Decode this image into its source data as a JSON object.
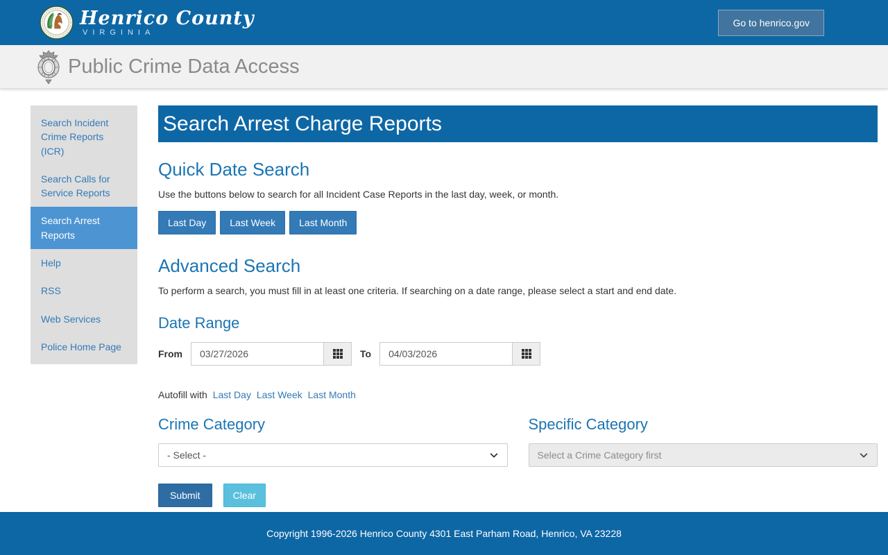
{
  "theme": {
    "bar_blue": "#0e67a5",
    "heading_blue": "#1b75b3",
    "link_blue": "#337ab7",
    "active_item_blue": "#4d94d2",
    "submit_blue": "#2e6da4",
    "clear_blue": "#5bc0de"
  },
  "top_bar": {
    "logo_title": "Henrico County",
    "logo_subtitle": "VIRGINIA",
    "go_button_label": "Go to henrico.gov"
  },
  "site_header": {
    "title": "Public Crime Data Access"
  },
  "sidebar": {
    "items": [
      {
        "label": "Search Incident Crime Reports (ICR)",
        "active": false
      },
      {
        "label": "Search Calls for Service Reports",
        "active": false
      },
      {
        "label": "Search Arrest Reports",
        "active": true
      },
      {
        "label": "Help",
        "active": false
      },
      {
        "label": "RSS",
        "active": false
      },
      {
        "label": "Web Services",
        "active": false
      },
      {
        "label": "Police Home Page",
        "active": false
      }
    ]
  },
  "main": {
    "page_title": "Search Arrest Charge Reports",
    "quick": {
      "heading": "Quick Date Search",
      "description": "Use the buttons below to search for all Incident Case Reports in the last day, week, or month.",
      "buttons": [
        "Last Day",
        "Last Week",
        "Last Month"
      ]
    },
    "advanced": {
      "heading": "Advanced Search",
      "description": "To perform a search, you must fill in at least one criteria. If searching on a date range, please select a start and end date."
    },
    "date_range": {
      "heading": "Date Range",
      "from_label": "From",
      "from_value": "03/27/2026",
      "to_label": "To",
      "to_value": "04/03/2026",
      "autofill_label": "Autofill with",
      "autofill_links": [
        "Last Day",
        "Last Week",
        "Last Month"
      ]
    },
    "crime_category": {
      "heading": "Crime Category",
      "selected": "- Select -"
    },
    "specific_category": {
      "heading": "Specific Category",
      "selected": "Select a Crime Category first"
    },
    "submit_label": "Submit",
    "clear_label": "Clear"
  },
  "footer": {
    "text": "Copyright 1996-2026 Henrico County 4301 East Parham Road, Henrico, VA 23228"
  }
}
